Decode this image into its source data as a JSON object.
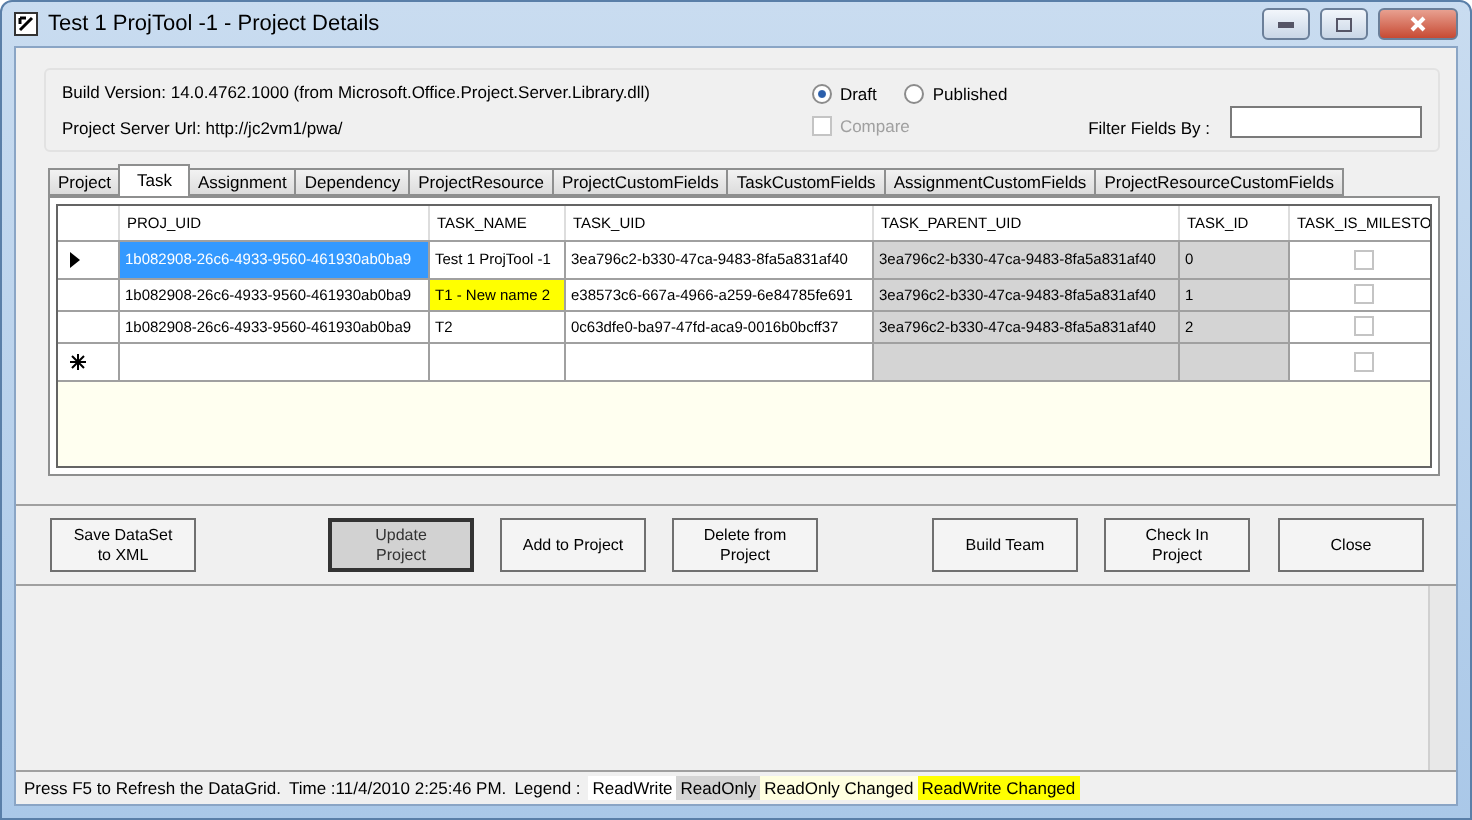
{
  "window": {
    "title": "Test 1 ProjTool -1  -  Project Details"
  },
  "info": {
    "build_version": "Build Version: 14.0.4762.1000  (from Microsoft.Office.Project.Server.Library.dll)",
    "server_url": "Project Server Url: http://jc2vm1/pwa/"
  },
  "mode": [
    {
      "label": "Draft",
      "selected": true
    },
    {
      "label": "Published",
      "selected": false
    }
  ],
  "compare": {
    "label": "Compare",
    "checked": false,
    "disabled": true
  },
  "filter": {
    "label": "Filter Fields By :"
  },
  "tabs": [
    {
      "label": "Project",
      "selected": false
    },
    {
      "label": "Task",
      "selected": true
    },
    {
      "label": "Assignment",
      "selected": false
    },
    {
      "label": "Dependency",
      "selected": false
    },
    {
      "label": "ProjectResource",
      "selected": false
    },
    {
      "label": "ProjectCustomFields",
      "selected": false
    },
    {
      "label": "TaskCustomFields",
      "selected": false
    },
    {
      "label": "AssignmentCustomFields",
      "selected": false
    },
    {
      "label": "ProjectResourceCustomFields",
      "selected": false
    }
  ],
  "table": {
    "columns": [
      "PROJ_UID",
      "TASK_NAME",
      "TASK_UID",
      "TASK_PARENT_UID",
      "TASK_ID",
      "TASK_IS_MILESTO"
    ],
    "rows": [
      {
        "kind": "current",
        "cells": [
          {
            "text": "1b082908-26c6-4933-9560-461930ab0ba9",
            "kind": "selected"
          },
          {
            "text": "Test 1 ProjTool -1",
            "kind": "readwrite"
          },
          {
            "text": "3ea796c2-b330-47ca-9483-8fa5a831af40",
            "kind": "readwrite"
          },
          {
            "text": "3ea796c2-b330-47ca-9483-8fa5a831af40",
            "kind": "readonly"
          },
          {
            "text": "0",
            "kind": "readonly"
          }
        ],
        "checked": false
      },
      {
        "kind": "normal",
        "cells": [
          {
            "text": "1b082908-26c6-4933-9560-461930ab0ba9",
            "kind": "readwrite"
          },
          {
            "text": "T1 - New name 2",
            "kind": "changed"
          },
          {
            "text": "e38573c6-667a-4966-a259-6e84785fe691",
            "kind": "readwrite"
          },
          {
            "text": "3ea796c2-b330-47ca-9483-8fa5a831af40",
            "kind": "readonly"
          },
          {
            "text": "1",
            "kind": "readonly"
          }
        ],
        "checked": false
      },
      {
        "kind": "normal",
        "cells": [
          {
            "text": "1b082908-26c6-4933-9560-461930ab0ba9",
            "kind": "readwrite"
          },
          {
            "text": "T2",
            "kind": "readwrite"
          },
          {
            "text": "0c63dfe0-ba97-47fd-aca9-0016b0bcff37",
            "kind": "readwrite"
          },
          {
            "text": "3ea796c2-b330-47ca-9483-8fa5a831af40",
            "kind": "readonly"
          },
          {
            "text": "2",
            "kind": "readonly"
          }
        ],
        "checked": false
      },
      {
        "kind": "new",
        "cells": [
          {
            "text": "",
            "kind": "readwrite"
          },
          {
            "text": "",
            "kind": "readwrite"
          },
          {
            "text": "",
            "kind": "readwrite"
          },
          {
            "text": "",
            "kind": "readonly"
          },
          {
            "text": "",
            "kind": "readonly"
          }
        ],
        "checked": false
      }
    ]
  },
  "buttons": [
    {
      "label": "Save DataSet to XML",
      "selected": false
    },
    {
      "label": "Update Project",
      "selected": true
    },
    {
      "label": "Add to Project",
      "selected": false
    },
    {
      "label": "Delete from Project",
      "selected": false
    },
    {
      "label": "Build Team",
      "selected": false
    },
    {
      "label": "Check In Project",
      "selected": false
    },
    {
      "label": "Close",
      "selected": false
    }
  ],
  "status_bar": {
    "message": "Press F5 to Refresh the DataGrid.",
    "time": "Time :11/4/2010 2:25:46 PM.",
    "legend_label": "Legend :",
    "legend": [
      {
        "label": "ReadWrite",
        "kind": "readwrite"
      },
      {
        "label": "ReadOnly",
        "kind": "readonly"
      },
      {
        "label": "ReadOnly Changed",
        "kind": "rochanged"
      },
      {
        "label": "ReadWrite Changed",
        "kind": "changed"
      }
    ]
  }
}
